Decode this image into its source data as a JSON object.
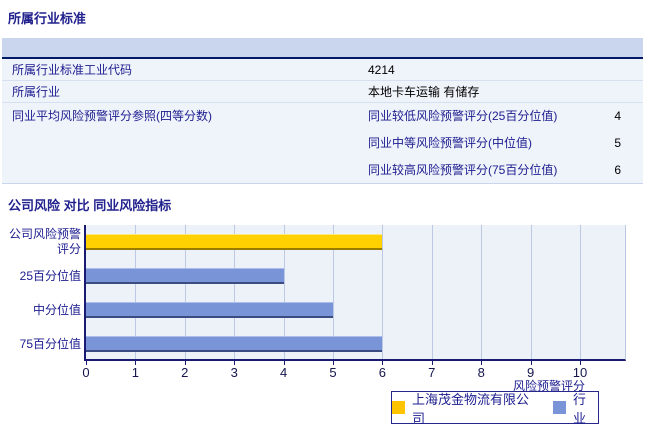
{
  "sections": {
    "industry_standard": {
      "title": "所属行业标准"
    },
    "comparison": {
      "title": "公司风险 对比 同业风险指标"
    }
  },
  "table": {
    "rows": [
      {
        "label": "所属行业标准工业代码",
        "value": "4214"
      },
      {
        "label": "所属行业",
        "value": "本地卡车运输 有储存"
      },
      {
        "label": "同业平均风险预警评分参照(四等分数)",
        "subrows": [
          {
            "label": "同业较低风险预警评分(25百分位值)",
            "value": "4"
          },
          {
            "label": "同业中等风险预警评分(中位值)",
            "value": "5"
          },
          {
            "label": "同业较高风险预警评分(75百分位值)",
            "value": "6"
          }
        ]
      }
    ]
  },
  "chart_data": {
    "type": "bar",
    "orientation": "horizontal",
    "title": "公司风险 对比 同业风险指标",
    "categories": [
      "公司风险预警评分",
      "25百分位值",
      "中分位值",
      "75百分位值"
    ],
    "values": [
      6,
      4,
      5,
      6
    ],
    "series_map": [
      "company",
      "industry",
      "industry",
      "industry"
    ],
    "xlabel": "风险预警评分",
    "xticks": [
      0,
      1,
      2,
      3,
      4,
      5,
      6,
      7,
      8,
      9,
      10
    ],
    "xlim": [
      0,
      10.9
    ],
    "grid": true,
    "legend_position": "bottom-right",
    "legend": [
      {
        "name": "上海茂金物流有限公司",
        "series": "company",
        "color": "#FFC400"
      },
      {
        "name": "行业",
        "series": "industry",
        "color": "#7A94D8"
      }
    ],
    "colors": {
      "company": "#FFD100",
      "industry": "#7A94D8"
    }
  }
}
